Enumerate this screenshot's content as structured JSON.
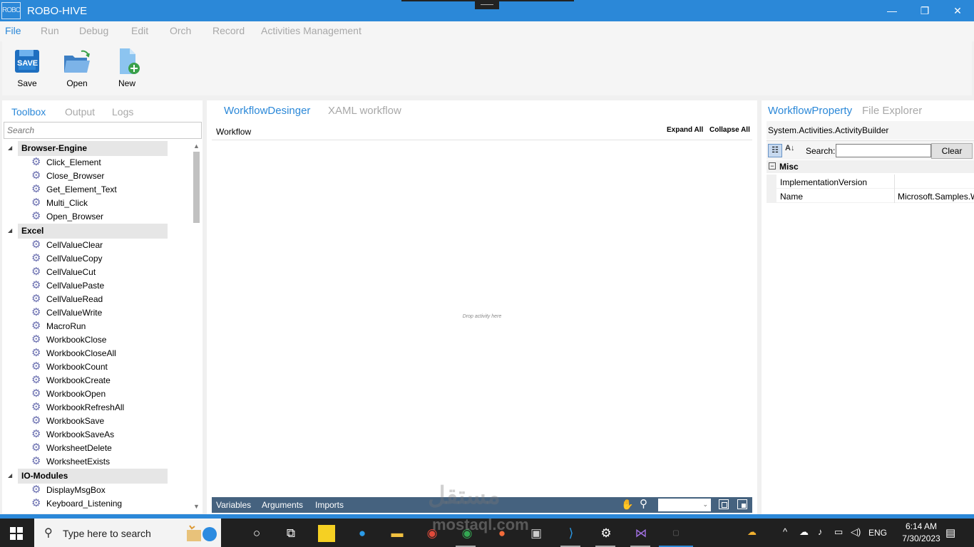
{
  "window": {
    "title": "ROBO-HIVE",
    "logo_text": "ROBO",
    "minimize": "—",
    "maximize": "❐",
    "close": "✕"
  },
  "menu": [
    "File",
    "Run",
    "Debug",
    "Edit",
    "Orch",
    "Record",
    "Activities Management"
  ],
  "ribbon": {
    "save_label": "Save",
    "save_icon_text": "SAVE",
    "open_label": "Open",
    "new_label": "New"
  },
  "left_panel": {
    "tabs": [
      "Toolbox",
      "Output",
      "Logs"
    ],
    "search_placeholder": "Search",
    "groups": [
      {
        "name": "Browser-Engine",
        "items": [
          "Click_Element",
          "Close_Browser",
          "Get_Element_Text",
          "Multi_Click",
          "Open_Browser"
        ]
      },
      {
        "name": "Excel",
        "items": [
          "CellValueClear",
          "CellValueCopy",
          "CellValueCut",
          "CellValuePaste",
          "CellValueRead",
          "CellValueWrite",
          "MacroRun",
          "WorkbookClose",
          "WorkbookCloseAll",
          "WorkbookCount",
          "WorkbookCreate",
          "WorkbookOpen",
          "WorkbookRefreshAll",
          "WorkbookSave",
          "WorkbookSaveAs",
          "WorksheetDelete",
          "WorksheetExists"
        ]
      },
      {
        "name": "IO-Modules",
        "items": [
          "DisplayMsgBox",
          "Keyboard_Listening"
        ]
      }
    ]
  },
  "center_panel": {
    "tabs": [
      "WorkflowDesinger",
      "XAML workflow"
    ],
    "breadcrumb": "Workflow",
    "expand_all": "Expand All",
    "collapse_all": "Collapse All",
    "drop_hint": "Drop activity here",
    "footer": {
      "variables": "Variables",
      "arguments": "Arguments",
      "imports": "Imports",
      "zoom_arrow": "⌄"
    }
  },
  "right_panel": {
    "tabs": [
      "WorkflowProperty",
      "File Explorer"
    ],
    "type_name": "System.Activities.ActivityBuilder",
    "search_label": "Search:",
    "clear_label": "Clear",
    "category": {
      "toggle": "−",
      "name": "Misc"
    },
    "properties": [
      {
        "name": "ImplementationVersion",
        "value": ""
      },
      {
        "name": "Name",
        "value": "Microsoft.Samples.W"
      }
    ]
  },
  "taskbar": {
    "search_text": "Type here to search",
    "language": "ENG",
    "time": "6:14 AM",
    "date": "7/30/2023"
  },
  "watermark": {
    "line1": "مستقل",
    "line2": "mostaql.com"
  },
  "colors": {
    "accent": "#2b88d8",
    "footer": "#45627f",
    "taskbar": "#202020"
  }
}
